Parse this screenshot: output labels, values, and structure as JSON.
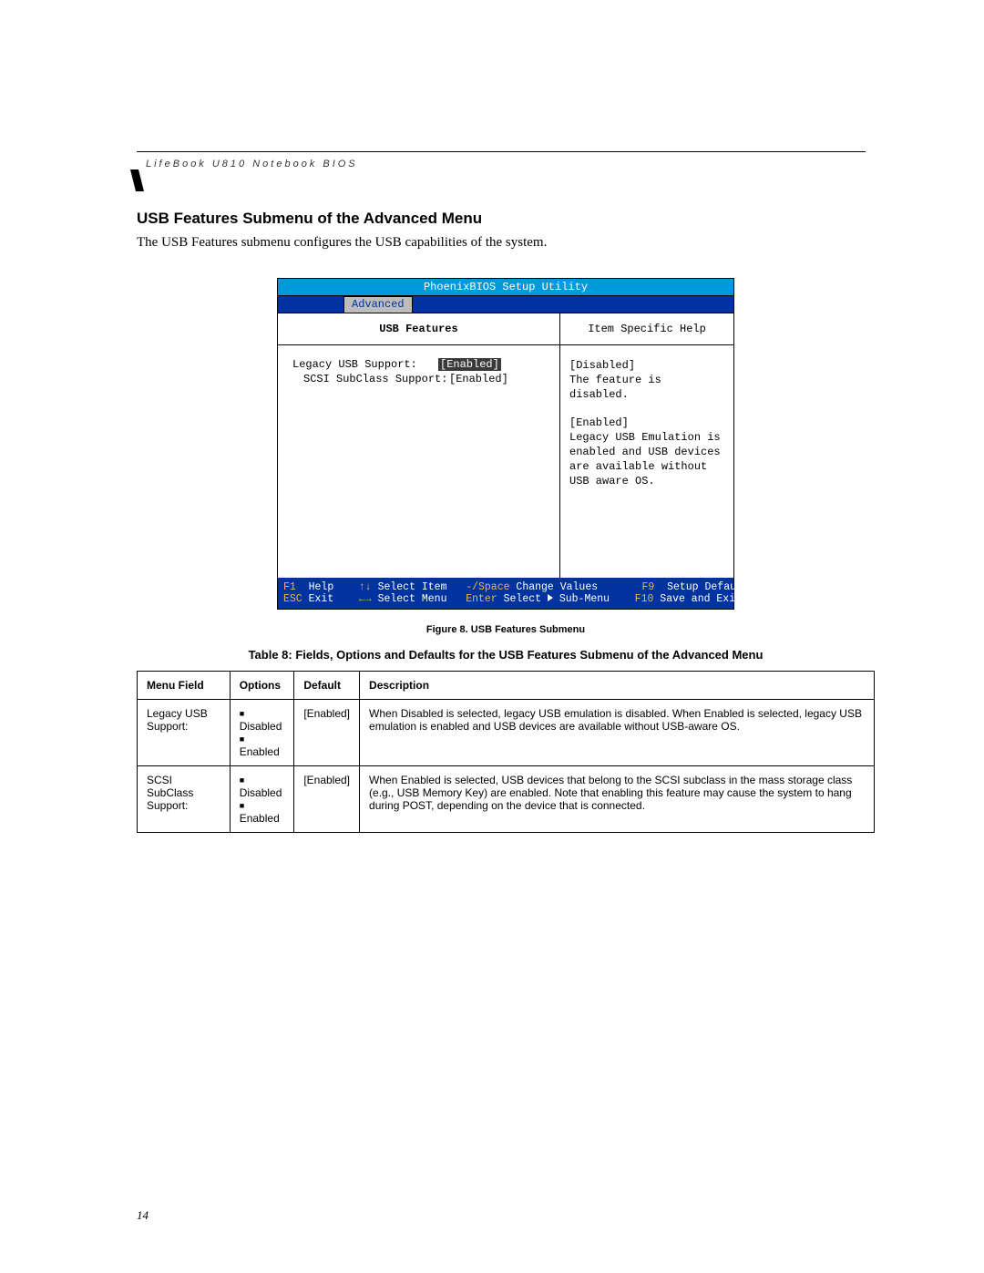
{
  "header": "LifeBook U810 Notebook BIOS",
  "section_title": "USB Features Submenu of the Advanced Menu",
  "intro": "The USB Features submenu configures the USB capabilities of the system.",
  "bios": {
    "utility_title": "PhoenixBIOS Setup Utility",
    "active_tab": "Advanced",
    "left_title": "USB Features",
    "right_title": "Item Specific Help",
    "fields": [
      {
        "label": "Legacy USB Support:",
        "value": "[Enabled]",
        "selected": true,
        "indent": false
      },
      {
        "label": "SCSI SubClass Support:",
        "value": "[Enabled]",
        "selected": false,
        "indent": true
      }
    ],
    "help": {
      "disabled_label": "[Disabled]",
      "disabled_text": "The feature is disabled.",
      "enabled_label": "[Enabled]",
      "enabled_text": "Legacy USB Emulation is enabled and USB devices are available without USB aware OS."
    },
    "footer": {
      "f1": "F1",
      "help": "Help",
      "select_item": "Select Item",
      "change_values_key": "-/Space",
      "change_values": "Change Values",
      "f9": "F9",
      "setup_defaults": "Setup Defaults",
      "esc": "ESC",
      "exit": "Exit",
      "select_menu": "Select Menu",
      "enter": "Enter",
      "select_submenu": "Select    Sub-Menu",
      "f10": "F10",
      "save_exit": "Save and Exit"
    }
  },
  "figure_caption": "Figure 8.   USB Features Submenu",
  "table_title": "Table 8: Fields, Options and Defaults for the USB Features Submenu of the Advanced Menu",
  "table": {
    "headers": [
      "Menu Field",
      "Options",
      "Default",
      "Description"
    ],
    "rows": [
      {
        "field": "Legacy USB Support:",
        "options": [
          "Disabled",
          "Enabled"
        ],
        "default": "[Enabled]",
        "description": "When Disabled is selected, legacy USB emulation is disabled. When Enabled is selected, legacy USB emulation is enabled and USB devices are available without USB-aware OS."
      },
      {
        "field": "SCSI SubClass Support:",
        "options": [
          "Disabled",
          "Enabled"
        ],
        "default": "[Enabled]",
        "description": "When Enabled is selected, USB devices that belong to the SCSI subclass in the mass storage class (e.g., USB Memory Key) are enabled. Note that enabling this feature may cause the system to hang during POST, depending on the device that is connected."
      }
    ]
  },
  "page_number": "14"
}
